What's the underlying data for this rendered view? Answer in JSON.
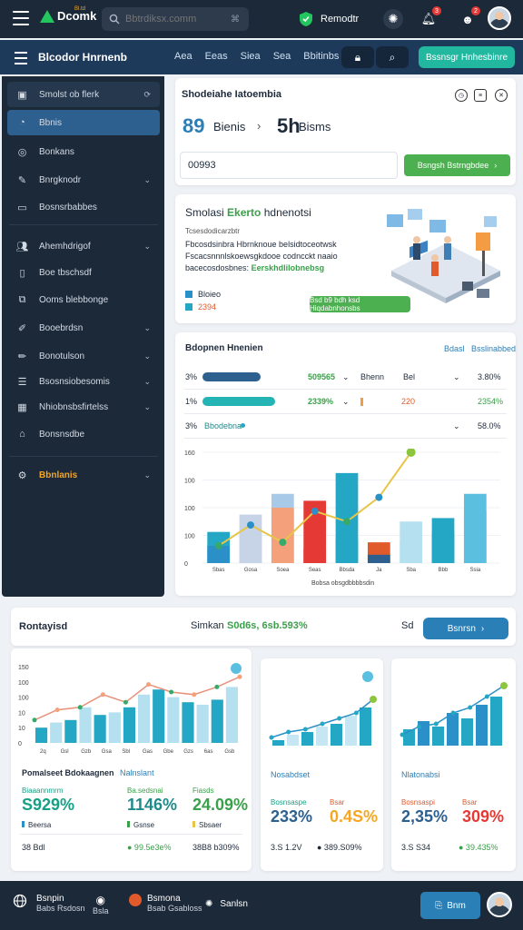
{
  "topbar": {
    "logo_text": "Dcomk",
    "logo_sup": "Bl.td",
    "search_placeholder": "Bbtrdiksx.comm",
    "search_kbd": "⌘",
    "status_label": "Remodtr",
    "notif_count": "3",
    "alert_count": "2"
  },
  "navbar": {
    "title": "Blcodor Hnrnenb",
    "links": [
      "Aea",
      "Eeas",
      "Siea",
      "Sea",
      "Bbitinbs"
    ],
    "cta": "Bssnsgr Hnhesbinre"
  },
  "sidebar": {
    "items": [
      {
        "label": "Smolst ob flerk",
        "icon": "dashboard-icon"
      },
      {
        "label": "Bbnis",
        "icon": "chart-icon"
      },
      {
        "label": "Bonkans",
        "icon": "compass-icon"
      },
      {
        "label": "Bnrgknodr",
        "icon": "pen-icon"
      },
      {
        "label": "Bosnsrbabbes",
        "icon": "monitor-icon"
      },
      {
        "label": "Ahemhdrigof",
        "icon": "users-icon"
      },
      {
        "label": "Boe tbschsdf",
        "icon": "document-icon"
      },
      {
        "label": "Ooms blebbonge",
        "icon": "copy-icon"
      },
      {
        "label": "Booebrdsn",
        "icon": "edit-icon"
      },
      {
        "label": "Bonotulson",
        "icon": "pencil-icon"
      },
      {
        "label": "Bsosnsiobesomis",
        "icon": "list-icon"
      },
      {
        "label": "Nhiobnsbsfirtelss",
        "icon": "grid-icon"
      },
      {
        "label": "Bonsnsdbe",
        "icon": "home-icon"
      },
      {
        "label": "Bbnlanis",
        "icon": "settings-icon"
      }
    ]
  },
  "summary": {
    "title": "Shodeiahe Iatoembia",
    "stat1_value": "89",
    "stat1_label": "Bienis",
    "stat2_value": "5h",
    "stat2_label": "Bisms",
    "input_value": "00993",
    "button": "Bsngsh Bstrngbdee"
  },
  "promo": {
    "title_prefix": "Smolasi",
    "title_highlight": "Ekerto",
    "title_suffix": "hdnenotsi",
    "subtitle": "Tcsesdodicarzbtr",
    "line1": "Fbcosdsinbra Hbrnknoue belsidtoceotwsk",
    "line2": "Fscacsnnnlskoewsgkdooe codncckt naaio",
    "line3": "bacecosdosbnes:",
    "line3_link": "Eerskhdlilobnebsg",
    "leg1": "Bloieo",
    "leg2": "2394",
    "button": "Bsd b9 bdh ksd Hiqdabnhonsbs"
  },
  "analytics": {
    "title": "Bdopnen Hnenien",
    "link1": "Bdasl",
    "link2": "Bsslinabbed",
    "rows": [
      {
        "pct": "3%",
        "value": "509565",
        "label": "Bhenn",
        "extra": "Bel",
        "right": "3.80%"
      },
      {
        "pct": "1%",
        "value": "2339%",
        "label": "",
        "extra": "220",
        "right": "2354%"
      },
      {
        "pct": "3%",
        "value": "Bbodebna",
        "label": "",
        "extra": "",
        "right": "58.0%"
      }
    ],
    "xlabel": "Bobsa obsgdbbbbsdin"
  },
  "chart_data": [
    {
      "type": "bar",
      "categories": [
        "Sbas",
        "Gosa",
        "Soea",
        "Seas",
        "Bbsda",
        "Ja",
        "Sba",
        "Bbb",
        "Ssia"
      ],
      "ylabel": "",
      "ytick_labels": [
        "0",
        "100",
        "100",
        "100",
        "160"
      ],
      "series": [
        {
          "values": [
            45,
            70,
            100,
            90,
            130,
            30,
            60,
            65,
            100
          ]
        },
        {
          "values": [
            25,
            45,
            80,
            20,
            35,
            12,
            30,
            45,
            75
          ]
        }
      ],
      "line": [
        25,
        55,
        30,
        75,
        60,
        95,
        160
      ],
      "colors": {
        "blue": "#2b8fc8",
        "teal": "#24a7c4",
        "orange": "#f4a07a",
        "red": "#e53935",
        "light": "#c7d3e6",
        "yellow": "#e8c547",
        "green": "#38a86b"
      }
    },
    {
      "type": "bar",
      "categories": [
        "2q",
        "Gsl",
        "Gzb",
        "Gsa",
        "Sbl",
        "Gas",
        "Gbe",
        "Gzs",
        "6as",
        "Gsb"
      ],
      "ytick_labels": [
        "0",
        "10",
        "10",
        "100",
        "100",
        "150"
      ],
      "values": [
        30,
        40,
        45,
        70,
        55,
        60,
        70,
        95,
        105,
        90,
        80,
        75,
        85,
        110
      ],
      "line": [
        45,
        65,
        70,
        95,
        80,
        115,
        100,
        95,
        110,
        130
      ]
    },
    {
      "type": "bar",
      "values": [
        10,
        20,
        25,
        35,
        40,
        55,
        70
      ],
      "line": [
        15,
        25,
        30,
        40,
        50,
        60,
        85
      ]
    },
    {
      "type": "bar",
      "values": [
        30,
        45,
        35,
        60,
        50,
        75,
        90
      ],
      "line": [
        20,
        35,
        40,
        60,
        70,
        90,
        110
      ]
    }
  ],
  "mid": {
    "left": "Rontayisd",
    "center_label": "Simkan",
    "center_value": "S0d6s, 6sb.593%",
    "right": "Sd",
    "button": "Bsnrsn"
  },
  "bottom": {
    "card1": {
      "title": "Pomalseet Bdokaagnen",
      "title2": "Nalnslant",
      "stats": [
        {
          "lbl": "Biaaannmrm",
          "val": "S929%",
          "sub": "Beersa",
          "color": "#16a085"
        },
        {
          "lbl": "Ba.sedsnai",
          "val": "1146%",
          "sub": "Gsnse",
          "color": "#1f8a8a"
        },
        {
          "lbl": "Fiasds",
          "val": "24.09%",
          "sub": "Sbsaer",
          "color": "#3aa04a"
        }
      ],
      "foot1": "38  Bdl",
      "foot2": "● 99.5e3e%",
      "foot3": "38B8 b309%"
    },
    "card2": {
      "title": "Nosabdset",
      "stat1_lbl": "Bosnsaspe",
      "stat1": "233%",
      "stat2_lbl": "Bsar",
      "stat2": "0.4S%",
      "foot1": "3.S  1.2V",
      "foot2": "● 389.S09%"
    },
    "card3": {
      "title": "Nlatonabsi",
      "stat1_lbl": "Bosnsaspi",
      "stat1": "2,35%",
      "stat2_lbl": "Bsar",
      "stat2": "309%",
      "foot1": "3.S  S34",
      "foot2": "● 39.435%"
    }
  },
  "footer": {
    "item1": "Bsnpin",
    "item1_sub": "Babs  Rsdosn",
    "item2": "Bsla",
    "item3": "Bsmona",
    "item3_sub": "Bsab  Gsabloss",
    "item4": "Sanlsn",
    "button": "Bnm"
  }
}
